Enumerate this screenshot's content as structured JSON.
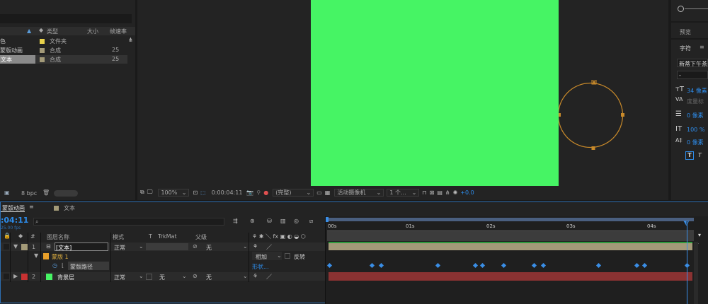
{
  "project": {
    "columns": {
      "type": "类型",
      "size": "大小",
      "fps": "帧速率"
    },
    "items": [
      {
        "name": "色",
        "type": "文件夹",
        "fps": "",
        "color": "#e8d24a"
      },
      {
        "name": "蒙版动画",
        "type": "合成",
        "fps": "25",
        "color": "#a39a78"
      },
      {
        "name": "文本",
        "type": "合成",
        "fps": "25",
        "color": "#a39a78"
      }
    ],
    "bpc": "8 bpc"
  },
  "viewer": {
    "zoom": "100%",
    "timecode": "0:00:04:11",
    "quality": "(完整)",
    "camera": "活动摄像机",
    "views": "1 个...",
    "exposure": "+0.0",
    "comp_color": "#46f464",
    "shape_color": "#c98a2a"
  },
  "right_panel": {
    "preview": "预览",
    "character": "字符",
    "font": "新蒂下午茶",
    "font_style": "-",
    "size": "34 像素",
    "tracking": "度量标",
    "leading": "0 像素",
    "vscale": "100 %",
    "baseline": "0 像素"
  },
  "timeline": {
    "tabs": [
      "蒙版动画",
      "文本"
    ],
    "current_time": ":04:11",
    "fps_label": "25.00 fps",
    "search_placeholder": "",
    "columns": {
      "num": "#",
      "layer_name": "图层名称",
      "mode": "模式",
      "t": "T",
      "trkmat": "TrkMat",
      "parent": "父级"
    },
    "ruler": [
      "00s",
      "01s",
      "02s",
      "03s",
      "04s"
    ],
    "layers": [
      {
        "num": "1",
        "name": "[文本]",
        "mode": "正常",
        "trkmat": "",
        "parent": "无",
        "color": "#a39a78"
      },
      {
        "num": "",
        "name": "蒙版 1",
        "mode": "相加",
        "extra": "反转",
        "color": "#e8a02a"
      },
      {
        "num": "",
        "name": "蒙版路径",
        "mode": "形状...",
        "color": ""
      },
      {
        "num": "2",
        "name": "背景层",
        "mode": "正常",
        "trkmat": "无",
        "parent": "无",
        "color": "#c83232"
      }
    ]
  }
}
